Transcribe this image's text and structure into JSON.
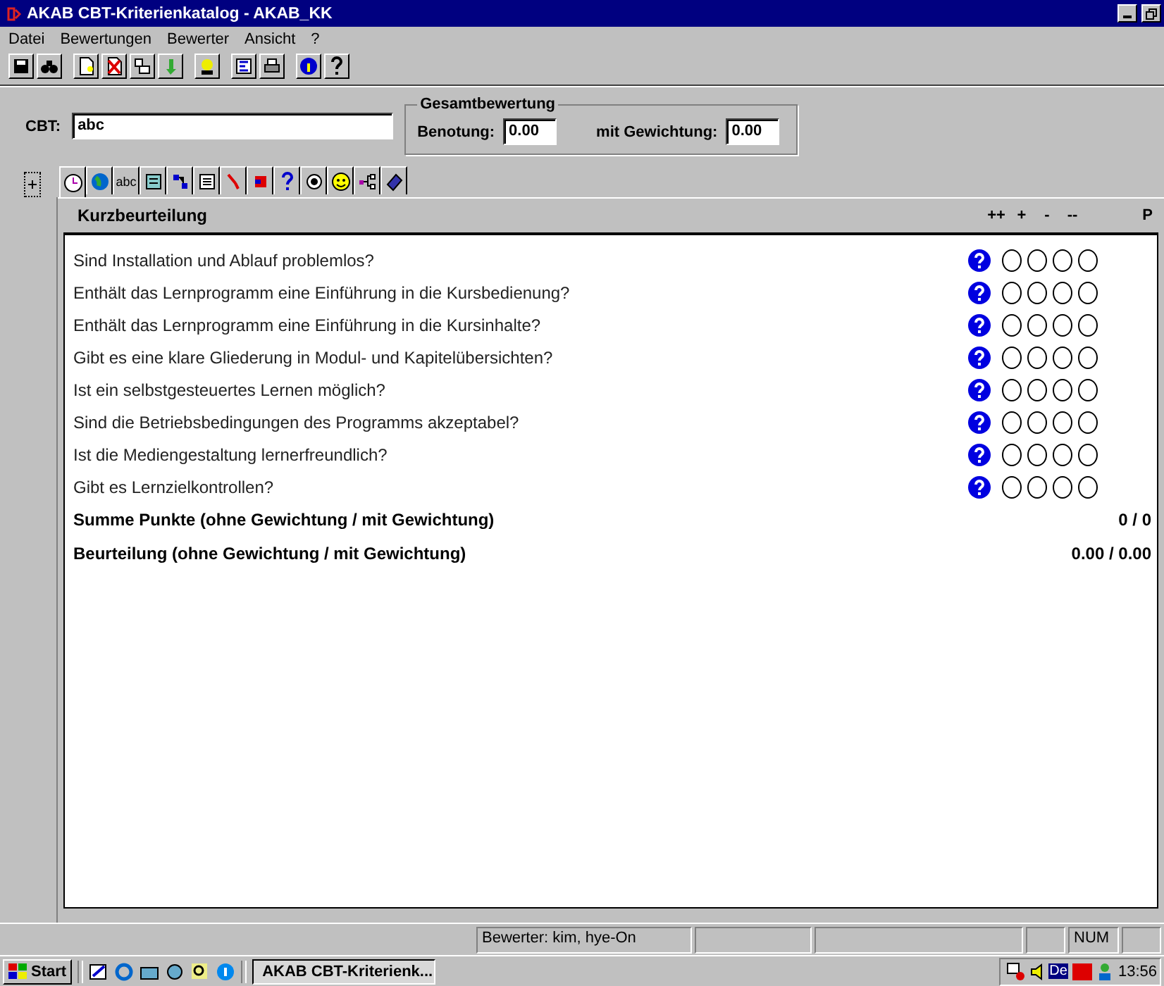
{
  "window": {
    "title": "AKAB CBT-Kriterienkatalog - AKAB_KK"
  },
  "menu": [
    "Datei",
    "Bewertungen",
    "Bewerter",
    "Ansicht",
    "?"
  ],
  "cbt": {
    "label": "CBT:",
    "value": "abc"
  },
  "gesamtbewertung": {
    "title": "Gesamtbewertung",
    "fields": [
      {
        "label": "Benotung:",
        "value": "0.00"
      },
      {
        "label": "mit Gewichtung:",
        "value": "0.00"
      }
    ]
  },
  "tabs": [
    {
      "selected": true
    },
    {
      "selected": false
    },
    {
      "selected": false,
      "label": "abc"
    },
    {
      "selected": false
    },
    {
      "selected": false
    },
    {
      "selected": false
    },
    {
      "selected": false
    },
    {
      "selected": false
    },
    {
      "selected": false
    },
    {
      "selected": false
    },
    {
      "selected": false
    },
    {
      "selected": false
    },
    {
      "selected": false
    }
  ],
  "panel": {
    "title": "Kurzbeurteilung",
    "columns": [
      "++",
      "+",
      "-",
      "--",
      "P"
    ],
    "questions": [
      {
        "text": "Sind Installation und Ablauf problemlos?",
        "options": [
          {
            "selected": false
          },
          {
            "selected": false
          },
          {
            "selected": false
          },
          {
            "selected": false
          }
        ]
      },
      {
        "text": "Enthält das Lernprogramm eine Einführung in die Kursbedienung?",
        "options": [
          {
            "selected": false
          },
          {
            "selected": false
          },
          {
            "selected": false
          },
          {
            "selected": false
          }
        ]
      },
      {
        "text": "Enthält das Lernprogramm eine Einführung in die Kursinhalte?",
        "options": [
          {
            "selected": false
          },
          {
            "selected": false
          },
          {
            "selected": false
          },
          {
            "selected": false
          }
        ]
      },
      {
        "text": "Gibt es eine klare Gliederung in Modul- und Kapitelübersichten?",
        "options": [
          {
            "selected": false
          },
          {
            "selected": false
          },
          {
            "selected": false
          },
          {
            "selected": false
          }
        ]
      },
      {
        "text": "Ist ein selbstgesteuertes Lernen möglich?",
        "options": [
          {
            "selected": false
          },
          {
            "selected": false
          },
          {
            "selected": false
          },
          {
            "selected": false
          }
        ]
      },
      {
        "text": "Sind die Betriebsbedingungen des Programms akzeptabel?",
        "options": [
          {
            "selected": false
          },
          {
            "selected": false
          },
          {
            "selected": false
          },
          {
            "selected": false
          }
        ]
      },
      {
        "text": "Ist die Mediengestaltung lernerfreundlich?",
        "options": [
          {
            "selected": false
          },
          {
            "selected": false
          },
          {
            "selected": false
          },
          {
            "selected": false
          }
        ]
      },
      {
        "text": "Gibt es Lernzielkontrollen?",
        "options": [
          {
            "selected": false
          },
          {
            "selected": false
          },
          {
            "selected": false
          },
          {
            "selected": false
          }
        ]
      }
    ],
    "summary": [
      {
        "label": "Summe Punkte (ohne Gewichtung / mit Gewichtung)",
        "value": "0 / 0"
      },
      {
        "label": "Beurteilung (ohne Gewichtung / mit Gewichtung)",
        "value": "0.00 / 0.00"
      }
    ]
  },
  "status_bar": {
    "bewerter": "Bewerter: kim, hye-On",
    "indicator": "NUM"
  },
  "taskbar": {
    "start": "Start",
    "task": "AKAB CBT-Kriterienk...",
    "tray_label": "De",
    "clock": "13:56"
  }
}
